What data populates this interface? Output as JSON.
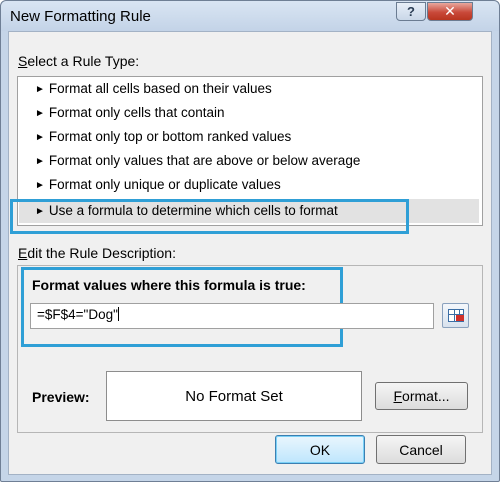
{
  "window": {
    "title": "New Formatting Rule",
    "help_glyph": "?",
    "close_glyph": "✕"
  },
  "rule_type": {
    "label_prefix": "",
    "label_accel": "S",
    "label_rest": "elect a Rule Type:",
    "arrow_glyph": "►",
    "items": [
      {
        "label": "Format all cells based on their values"
      },
      {
        "label": "Format only cells that contain"
      },
      {
        "label": "Format only top or bottom ranked values"
      },
      {
        "label": "Format only values that are above or below average"
      },
      {
        "label": "Format only unique or duplicate values"
      },
      {
        "label": "Use a formula to determine which cells to format",
        "selected": true
      }
    ]
  },
  "description": {
    "label_accel": "E",
    "label_rest": "dit the Rule Description:",
    "heading": "Format values where this formula is true:",
    "formula_value": "=$F$4=\"Dog\""
  },
  "preview": {
    "label": "Preview:",
    "text": "No Format Set"
  },
  "buttons": {
    "format_accel": "F",
    "format_rest": "ormat...",
    "ok": "OK",
    "cancel": "Cancel"
  },
  "colors": {
    "highlight_outline": "#2f9fd6",
    "selected_row": "#e2e2e2",
    "close_button": "#c9493a"
  }
}
